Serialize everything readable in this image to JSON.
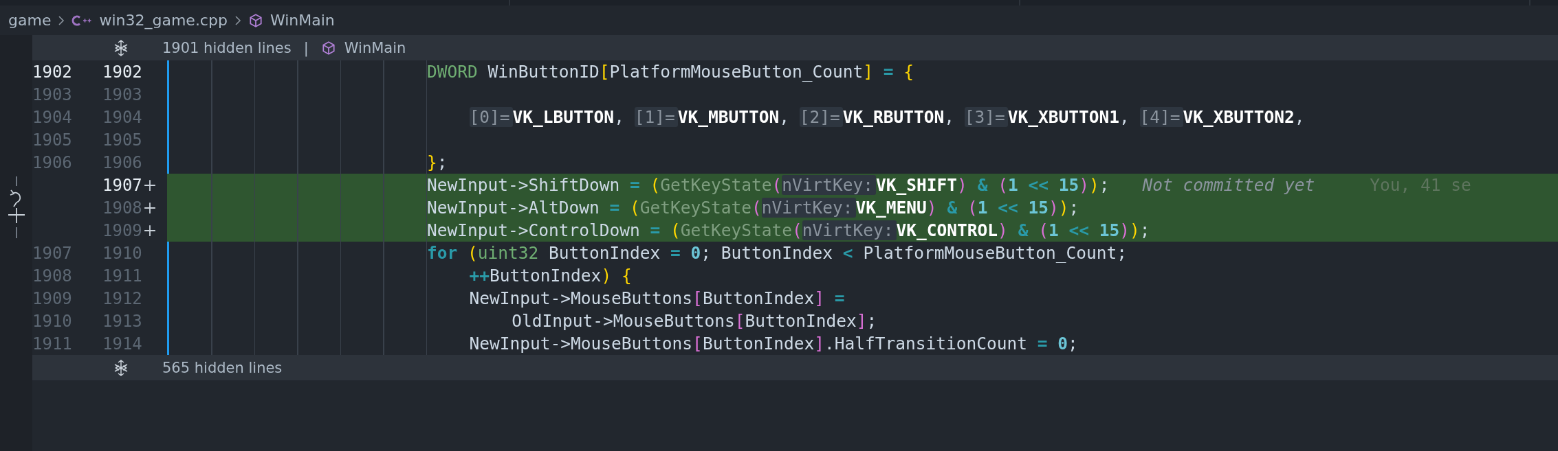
{
  "breadcrumb": [
    {
      "kind": "folder",
      "label": "game"
    },
    {
      "kind": "cpp-file",
      "label": "win32_game.cpp"
    },
    {
      "kind": "symbol",
      "label": "WinMain"
    }
  ],
  "top_fold": {
    "label": "1901 hidden lines",
    "separator": "|",
    "symbol": "WinMain"
  },
  "lines": [
    {
      "old": "1902",
      "new": "1902",
      "added": false,
      "active": true,
      "tokens": [
        {
          "kind": "type",
          "text": "DWORD"
        },
        {
          "kind": "plain",
          "text": " WinButtonID"
        },
        {
          "kind": "b1",
          "text": "["
        },
        {
          "kind": "plain",
          "text": "PlatformMouseButton_Count"
        },
        {
          "kind": "b1",
          "text": "]"
        },
        {
          "kind": "op",
          "text": " = "
        },
        {
          "kind": "b1",
          "text": "{"
        }
      ],
      "children": [
        {
          "old": "1903",
          "new": "1903",
          "added": false,
          "active": false
        },
        {
          "old": "1904",
          "new": "1904",
          "added": false,
          "active": false,
          "tokens": [
            {
              "kind": "hint",
              "text": "[0]="
            },
            {
              "kind": "const",
              "text": "VK_LBUTTON"
            },
            {
              "kind": "plain",
              "text": ", "
            },
            {
              "kind": "hint",
              "text": "[1]="
            },
            {
              "kind": "const",
              "text": "VK_MBUTTON"
            },
            {
              "kind": "plain",
              "text": ", "
            },
            {
              "kind": "hint",
              "text": "[2]="
            },
            {
              "kind": "const",
              "text": "VK_RBUTTON"
            },
            {
              "kind": "plain",
              "text": ", "
            },
            {
              "kind": "hint",
              "text": "[3]="
            },
            {
              "kind": "const",
              "text": "VK_XBUTTON1"
            },
            {
              "kind": "plain",
              "text": ", "
            },
            {
              "kind": "hint",
              "text": "[4]="
            },
            {
              "kind": "const",
              "text": "VK_XBUTTON2"
            },
            {
              "kind": "plain",
              "text": ","
            }
          ]
        },
        {
          "old": "1905",
          "new": "1905",
          "added": false,
          "active": false
        }
      ]
    },
    {
      "old": "1906",
      "new": "1906",
      "added": false,
      "active": false,
      "tokens": [
        {
          "kind": "b1",
          "text": "}"
        },
        {
          "kind": "plain",
          "text": ";"
        }
      ]
    },
    {
      "new": "1907",
      "added": true,
      "active": true,
      "tokens": [
        {
          "kind": "plain",
          "text": "NewInput->ShiftDown"
        },
        {
          "kind": "op",
          "text": " = "
        },
        {
          "kind": "b1",
          "text": "("
        },
        {
          "kind": "fn",
          "text": "GetKeyState"
        },
        {
          "kind": "b2",
          "text": "("
        },
        {
          "kind": "hint",
          "text": "nVirtKey:"
        },
        {
          "kind": "const",
          "text": "VK_SHIFT"
        },
        {
          "kind": "b2",
          "text": ")"
        },
        {
          "kind": "op",
          "text": " & "
        },
        {
          "kind": "b2",
          "text": "("
        },
        {
          "kind": "num",
          "text": "1"
        },
        {
          "kind": "op",
          "text": " << "
        },
        {
          "kind": "num",
          "text": "15"
        },
        {
          "kind": "b2",
          "text": ")"
        },
        {
          "kind": "b1",
          "text": ")"
        },
        {
          "kind": "plain",
          "text": ";"
        }
      ],
      "blame": {
        "message": "Not committed yet",
        "author": "You, 41 se"
      }
    },
    {
      "new": "1908",
      "added": true,
      "active": false,
      "tokens": [
        {
          "kind": "plain",
          "text": "NewInput->AltDown"
        },
        {
          "kind": "op",
          "text": " = "
        },
        {
          "kind": "b1",
          "text": "("
        },
        {
          "kind": "fn",
          "text": "GetKeyState"
        },
        {
          "kind": "b2",
          "text": "("
        },
        {
          "kind": "hint",
          "text": "nVirtKey:"
        },
        {
          "kind": "const",
          "text": "VK_MENU"
        },
        {
          "kind": "b2",
          "text": ")"
        },
        {
          "kind": "op",
          "text": " & "
        },
        {
          "kind": "b2",
          "text": "("
        },
        {
          "kind": "num",
          "text": "1"
        },
        {
          "kind": "op",
          "text": " << "
        },
        {
          "kind": "num",
          "text": "15"
        },
        {
          "kind": "b2",
          "text": ")"
        },
        {
          "kind": "b1",
          "text": ")"
        },
        {
          "kind": "plain",
          "text": ";"
        }
      ]
    },
    {
      "new": "1909",
      "added": true,
      "active": false,
      "tokens": [
        {
          "kind": "plain",
          "text": "NewInput->ControlDown"
        },
        {
          "kind": "op",
          "text": " = "
        },
        {
          "kind": "b1",
          "text": "("
        },
        {
          "kind": "fn",
          "text": "GetKeyState"
        },
        {
          "kind": "b2",
          "text": "("
        },
        {
          "kind": "hint",
          "text": "nVirtKey:"
        },
        {
          "kind": "const",
          "text": "VK_CONTROL"
        },
        {
          "kind": "b2",
          "text": ")"
        },
        {
          "kind": "op",
          "text": " & "
        },
        {
          "kind": "b2",
          "text": "("
        },
        {
          "kind": "num",
          "text": "1"
        },
        {
          "kind": "op",
          "text": " << "
        },
        {
          "kind": "num",
          "text": "15"
        },
        {
          "kind": "b2",
          "text": ")"
        },
        {
          "kind": "b1",
          "text": ")"
        },
        {
          "kind": "plain",
          "text": ";"
        }
      ]
    },
    {
      "old": "1907",
      "new": "1910",
      "added": false,
      "active": false,
      "tokens": [
        {
          "kind": "kw",
          "text": "for"
        },
        {
          "kind": "b1",
          "text": " ("
        },
        {
          "kind": "type",
          "text": "uint32"
        },
        {
          "kind": "plain",
          "text": " ButtonIndex"
        },
        {
          "kind": "op",
          "text": " = "
        },
        {
          "kind": "num",
          "text": "0"
        },
        {
          "kind": "plain",
          "text": "; ButtonIndex"
        },
        {
          "kind": "op",
          "text": " < "
        },
        {
          "kind": "plain",
          "text": "PlatformMouseButton_Count;"
        }
      ],
      "children": [
        {
          "old": "1908",
          "new": "1911",
          "added": false,
          "active": false,
          "tokens": [
            {
              "kind": "op",
              "text": "++"
            },
            {
              "kind": "plain",
              "text": "ButtonIndex"
            },
            {
              "kind": "b1",
              "text": ") {"
            }
          ]
        },
        {
          "old": "1909",
          "new": "1912",
          "added": false,
          "active": false,
          "tokens": [
            {
              "kind": "plain",
              "text": "NewInput->MouseButtons"
            },
            {
              "kind": "b2",
              "text": "["
            },
            {
              "kind": "plain",
              "text": "ButtonIndex"
            },
            {
              "kind": "b2",
              "text": "]"
            },
            {
              "kind": "op",
              "text": " ="
            }
          ],
          "children": [
            {
              "old": "1910",
              "new": "1913",
              "added": false,
              "active": false,
              "tokens": [
                {
                  "kind": "plain",
                  "text": "OldInput->MouseButtons"
                },
                {
                  "kind": "b2",
                  "text": "["
                },
                {
                  "kind": "plain",
                  "text": "ButtonIndex"
                },
                {
                  "kind": "b2",
                  "text": "]"
                },
                {
                  "kind": "plain",
                  "text": ";"
                }
              ]
            }
          ]
        },
        {
          "old": "1911",
          "new": "1914",
          "added": false,
          "active": false,
          "tokens": [
            {
              "kind": "plain",
              "text": "NewInput->MouseButtons"
            },
            {
              "kind": "b2",
              "text": "["
            },
            {
              "kind": "plain",
              "text": "ButtonIndex"
            },
            {
              "kind": "b2",
              "text": "]"
            },
            {
              "kind": "plain",
              "text": ".HalfTransitionCount"
            },
            {
              "kind": "op",
              "text": " = "
            },
            {
              "kind": "num",
              "text": "0"
            },
            {
              "kind": "plain",
              "text": ";"
            }
          ]
        }
      ]
    }
  ],
  "bottom_fold": {
    "label": "565 hidden lines"
  }
}
